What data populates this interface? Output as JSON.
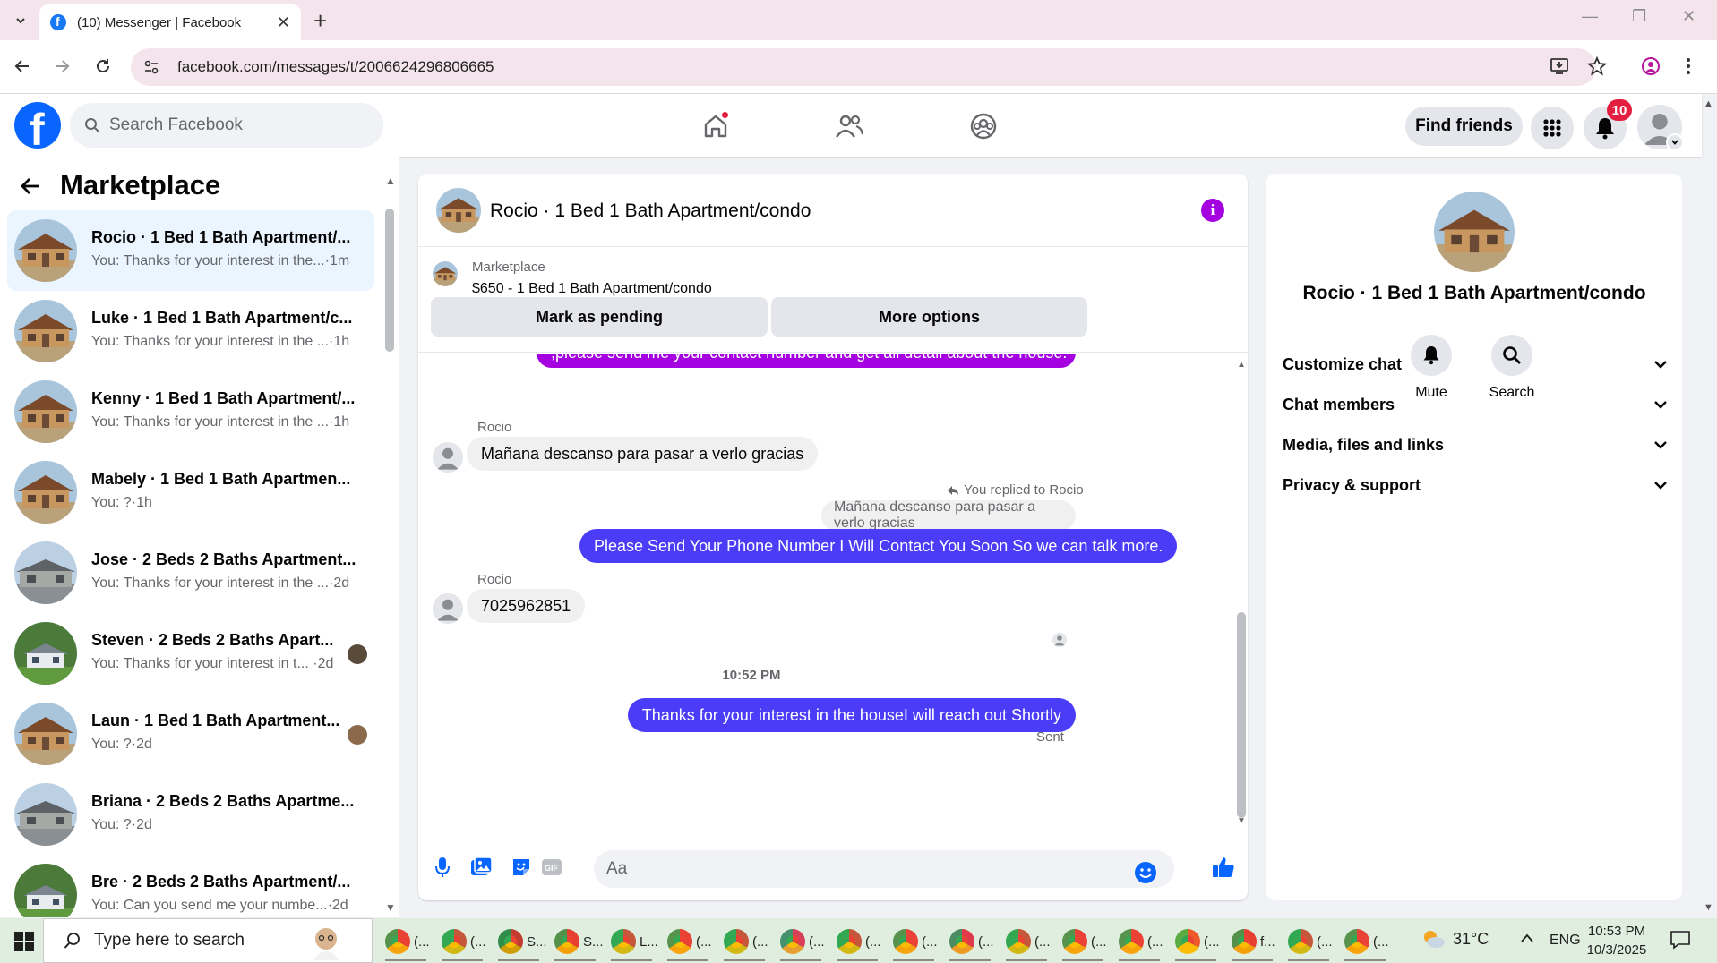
{
  "browser": {
    "tab_title": "(10) Messenger | Facebook",
    "url": "facebook.com/messages/t/2006624296806665"
  },
  "header": {
    "search_placeholder": "Search Facebook",
    "find_friends": "Find friends",
    "notification_count": "10"
  },
  "sidebar": {
    "title": "Marketplace",
    "conversations": [
      {
        "name": "Rocio · 1 Bed 1 Bath Apartment/...",
        "preview": "You: Thanks for your interest in the...·1m",
        "thumb": "house"
      },
      {
        "name": "Luke · 1 Bed 1 Bath Apartment/c...",
        "preview": "You: Thanks for your interest in the ...·1h",
        "thumb": "house"
      },
      {
        "name": "Kenny · 1 Bed 1 Bath Apartment/...",
        "preview": "You: Thanks for your interest in the ...·1h",
        "thumb": "house"
      },
      {
        "name": "Mabely · 1 Bed 1 Bath Apartmen...",
        "preview": "You: ?·1h",
        "thumb": "house"
      },
      {
        "name": "Jose · 2 Beds 2 Baths Apartment...",
        "preview": "You: Thanks for your interest in the ...·2d",
        "thumb": "grey-house"
      },
      {
        "name": "Steven · 2 Beds 2 Baths Apart...",
        "preview": "You: Thanks for your interest in t... ·2d",
        "thumb": "white-house"
      },
      {
        "name": "Laun · 1 Bed 1 Bath Apartment...",
        "preview": "You: ?·2d",
        "thumb": "house"
      },
      {
        "name": "Briana · 2 Beds 2 Baths Apartme...",
        "preview": "You: ?·2d",
        "thumb": "grey-house"
      },
      {
        "name": "Bre · 2 Beds 2 Baths Apartment/...",
        "preview": "You: Can you send me your numbe...·2d",
        "thumb": "white-house"
      }
    ]
  },
  "chat": {
    "title": "Rocio · 1 Bed 1 Bath Apartment/condo",
    "marketplace_label": "Marketplace",
    "listing": "$650 - 1 Bed 1 Bath Apartment/condo",
    "mark_pending": "Mark as pending",
    "more_options": "More options",
    "messages": {
      "partial_top": ",please send me your contact number and get all detail about the house.",
      "sender1": "Rocio",
      "in1": "Mañana descanso para pasar a verlo gracias",
      "replied_label": "You replied to Rocio",
      "quoted": "Mañana descanso para pasar a verlo gracias",
      "out1": "Please Send Your Phone Number I Will Contact You Soon So we can talk more.",
      "sender2": "Rocio",
      "in2": "7025962851",
      "timestamp": "10:52 PM",
      "out2": "Thanks for your interest in the houseI will reach out Shortly",
      "status": "Sent"
    },
    "composer_placeholder": "Aa"
  },
  "details": {
    "name": "Rocio · 1 Bed 1 Bath Apartment/condo",
    "mute": "Mute",
    "search": "Search",
    "sections": [
      "Customize chat",
      "Chat members",
      "Media, files and links",
      "Privacy & support"
    ]
  },
  "taskbar": {
    "search_placeholder": "Type here to search",
    "apps": [
      "(...",
      "(...",
      "S...",
      "S...",
      "L...",
      "(...",
      "(...",
      "(...",
      "(...",
      "(...",
      "(...",
      "(...",
      "(...",
      "(...",
      "(...",
      "f...",
      "(...",
      "(..."
    ],
    "temperature": "31°C",
    "language": "ENG",
    "time": "10:53 PM",
    "date": "10/3/2025"
  },
  "colors": {
    "fb_blue": "#0866ff",
    "outgoing_bubble": "#4a3cf7",
    "purple_accent": "#a400e0",
    "notification_red": "#e41e3f"
  }
}
